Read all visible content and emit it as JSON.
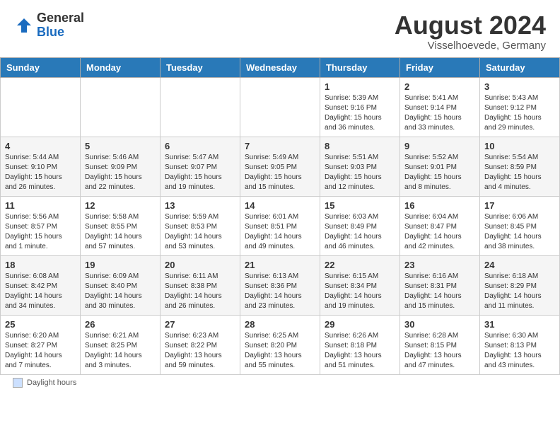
{
  "header": {
    "logo_general": "General",
    "logo_blue": "Blue",
    "month_title": "August 2024",
    "subtitle": "Visselhoevede, Germany"
  },
  "legend": {
    "label": "Daylight hours"
  },
  "days_of_week": [
    "Sunday",
    "Monday",
    "Tuesday",
    "Wednesday",
    "Thursday",
    "Friday",
    "Saturday"
  ],
  "weeks": [
    [
      {
        "day": "",
        "info": ""
      },
      {
        "day": "",
        "info": ""
      },
      {
        "day": "",
        "info": ""
      },
      {
        "day": "",
        "info": ""
      },
      {
        "day": "1",
        "info": "Sunrise: 5:39 AM\nSunset: 9:16 PM\nDaylight: 15 hours\nand 36 minutes."
      },
      {
        "day": "2",
        "info": "Sunrise: 5:41 AM\nSunset: 9:14 PM\nDaylight: 15 hours\nand 33 minutes."
      },
      {
        "day": "3",
        "info": "Sunrise: 5:43 AM\nSunset: 9:12 PM\nDaylight: 15 hours\nand 29 minutes."
      }
    ],
    [
      {
        "day": "4",
        "info": "Sunrise: 5:44 AM\nSunset: 9:10 PM\nDaylight: 15 hours\nand 26 minutes."
      },
      {
        "day": "5",
        "info": "Sunrise: 5:46 AM\nSunset: 9:09 PM\nDaylight: 15 hours\nand 22 minutes."
      },
      {
        "day": "6",
        "info": "Sunrise: 5:47 AM\nSunset: 9:07 PM\nDaylight: 15 hours\nand 19 minutes."
      },
      {
        "day": "7",
        "info": "Sunrise: 5:49 AM\nSunset: 9:05 PM\nDaylight: 15 hours\nand 15 minutes."
      },
      {
        "day": "8",
        "info": "Sunrise: 5:51 AM\nSunset: 9:03 PM\nDaylight: 15 hours\nand 12 minutes."
      },
      {
        "day": "9",
        "info": "Sunrise: 5:52 AM\nSunset: 9:01 PM\nDaylight: 15 hours\nand 8 minutes."
      },
      {
        "day": "10",
        "info": "Sunrise: 5:54 AM\nSunset: 8:59 PM\nDaylight: 15 hours\nand 4 minutes."
      }
    ],
    [
      {
        "day": "11",
        "info": "Sunrise: 5:56 AM\nSunset: 8:57 PM\nDaylight: 15 hours\nand 1 minute."
      },
      {
        "day": "12",
        "info": "Sunrise: 5:58 AM\nSunset: 8:55 PM\nDaylight: 14 hours\nand 57 minutes."
      },
      {
        "day": "13",
        "info": "Sunrise: 5:59 AM\nSunset: 8:53 PM\nDaylight: 14 hours\nand 53 minutes."
      },
      {
        "day": "14",
        "info": "Sunrise: 6:01 AM\nSunset: 8:51 PM\nDaylight: 14 hours\nand 49 minutes."
      },
      {
        "day": "15",
        "info": "Sunrise: 6:03 AM\nSunset: 8:49 PM\nDaylight: 14 hours\nand 46 minutes."
      },
      {
        "day": "16",
        "info": "Sunrise: 6:04 AM\nSunset: 8:47 PM\nDaylight: 14 hours\nand 42 minutes."
      },
      {
        "day": "17",
        "info": "Sunrise: 6:06 AM\nSunset: 8:45 PM\nDaylight: 14 hours\nand 38 minutes."
      }
    ],
    [
      {
        "day": "18",
        "info": "Sunrise: 6:08 AM\nSunset: 8:42 PM\nDaylight: 14 hours\nand 34 minutes."
      },
      {
        "day": "19",
        "info": "Sunrise: 6:09 AM\nSunset: 8:40 PM\nDaylight: 14 hours\nand 30 minutes."
      },
      {
        "day": "20",
        "info": "Sunrise: 6:11 AM\nSunset: 8:38 PM\nDaylight: 14 hours\nand 26 minutes."
      },
      {
        "day": "21",
        "info": "Sunrise: 6:13 AM\nSunset: 8:36 PM\nDaylight: 14 hours\nand 23 minutes."
      },
      {
        "day": "22",
        "info": "Sunrise: 6:15 AM\nSunset: 8:34 PM\nDaylight: 14 hours\nand 19 minutes."
      },
      {
        "day": "23",
        "info": "Sunrise: 6:16 AM\nSunset: 8:31 PM\nDaylight: 14 hours\nand 15 minutes."
      },
      {
        "day": "24",
        "info": "Sunrise: 6:18 AM\nSunset: 8:29 PM\nDaylight: 14 hours\nand 11 minutes."
      }
    ],
    [
      {
        "day": "25",
        "info": "Sunrise: 6:20 AM\nSunset: 8:27 PM\nDaylight: 14 hours\nand 7 minutes."
      },
      {
        "day": "26",
        "info": "Sunrise: 6:21 AM\nSunset: 8:25 PM\nDaylight: 14 hours\nand 3 minutes."
      },
      {
        "day": "27",
        "info": "Sunrise: 6:23 AM\nSunset: 8:22 PM\nDaylight: 13 hours\nand 59 minutes."
      },
      {
        "day": "28",
        "info": "Sunrise: 6:25 AM\nSunset: 8:20 PM\nDaylight: 13 hours\nand 55 minutes."
      },
      {
        "day": "29",
        "info": "Sunrise: 6:26 AM\nSunset: 8:18 PM\nDaylight: 13 hours\nand 51 minutes."
      },
      {
        "day": "30",
        "info": "Sunrise: 6:28 AM\nSunset: 8:15 PM\nDaylight: 13 hours\nand 47 minutes."
      },
      {
        "day": "31",
        "info": "Sunrise: 6:30 AM\nSunset: 8:13 PM\nDaylight: 13 hours\nand 43 minutes."
      }
    ]
  ]
}
